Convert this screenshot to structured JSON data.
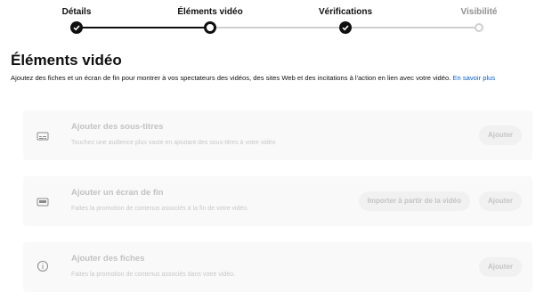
{
  "stepper": {
    "steps": [
      {
        "label": "Détails",
        "state": "done"
      },
      {
        "label": "Éléments vidéo",
        "state": "current"
      },
      {
        "label": "Vérifications",
        "state": "done"
      },
      {
        "label": "Visibilité",
        "state": "todo"
      }
    ]
  },
  "page": {
    "title": "Éléments vidéo",
    "description": "Ajoutez des fiches et un écran de fin pour montrer à vos spectateurs des vidéos, des sites Web et des incitations à l'action en lien avec votre vidéo.",
    "learn_more": "En savoir plus"
  },
  "cards": [
    {
      "icon": "subtitles-icon",
      "title": "Ajouter des sous-titres",
      "subtitle": "Touchez une audience plus vaste en ajoutant des sous-titres à votre vidéo",
      "buttons": [
        "Ajouter"
      ]
    },
    {
      "icon": "end-screen-icon",
      "title": "Ajouter un écran de fin",
      "subtitle": "Faites la promotion de contenus associés à la fin de votre vidéo.",
      "buttons": [
        "Importer à partir de la vidéo",
        "Ajouter"
      ]
    },
    {
      "icon": "info-icon",
      "title": "Ajouter des fiches",
      "subtitle": "Faites la promotion de contenus associés dans votre vidéo.",
      "buttons": [
        "Ajouter"
      ]
    }
  ]
}
